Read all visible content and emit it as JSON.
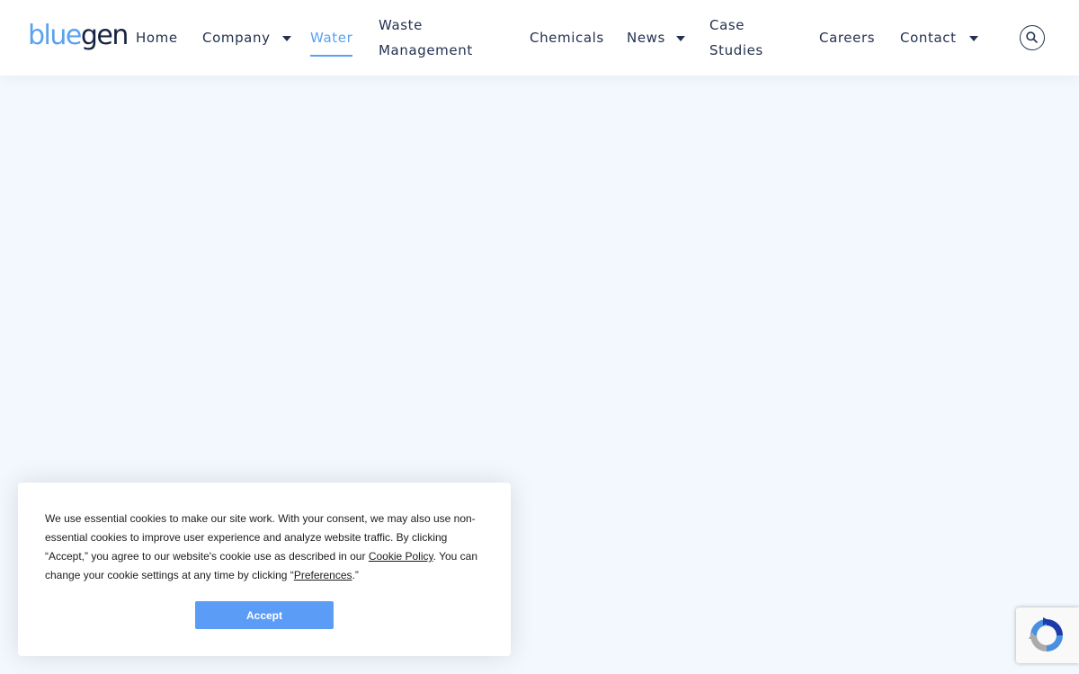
{
  "header": {
    "logo": {
      "part1": "blue",
      "part2": "gen"
    },
    "nav": [
      {
        "label": "Home"
      },
      {
        "label": "Company",
        "has_dropdown": true
      },
      {
        "label": "Water",
        "active": true
      },
      {
        "label": "Waste Management"
      },
      {
        "label": "Chemicals"
      },
      {
        "label": "News",
        "has_dropdown": true
      },
      {
        "label": "Case Studies"
      },
      {
        "label": "Careers"
      },
      {
        "label": "Contact",
        "has_dropdown": true
      }
    ],
    "search_icon": "search-icon"
  },
  "cookie_banner": {
    "text_before_policy": "We use essential cookies to make our site work. With your consent, we may also use non-essential cookies to improve user experience and analyze website traffic. By clicking “Accept,” you agree to our website's cookie use as described in our ",
    "policy_link": "Cookie Policy",
    "text_between": ". You can change your cookie settings at any time by clicking “",
    "preferences_link": "Preferences",
    "text_after": ".”",
    "accept_label": "Accept"
  },
  "recaptcha_icon": "recaptcha-icon",
  "colors": {
    "accent": "#5aa2ef",
    "nav_text": "#243150",
    "page_bg": "#f3f7fe",
    "accept_button": "#5b9cf7"
  }
}
